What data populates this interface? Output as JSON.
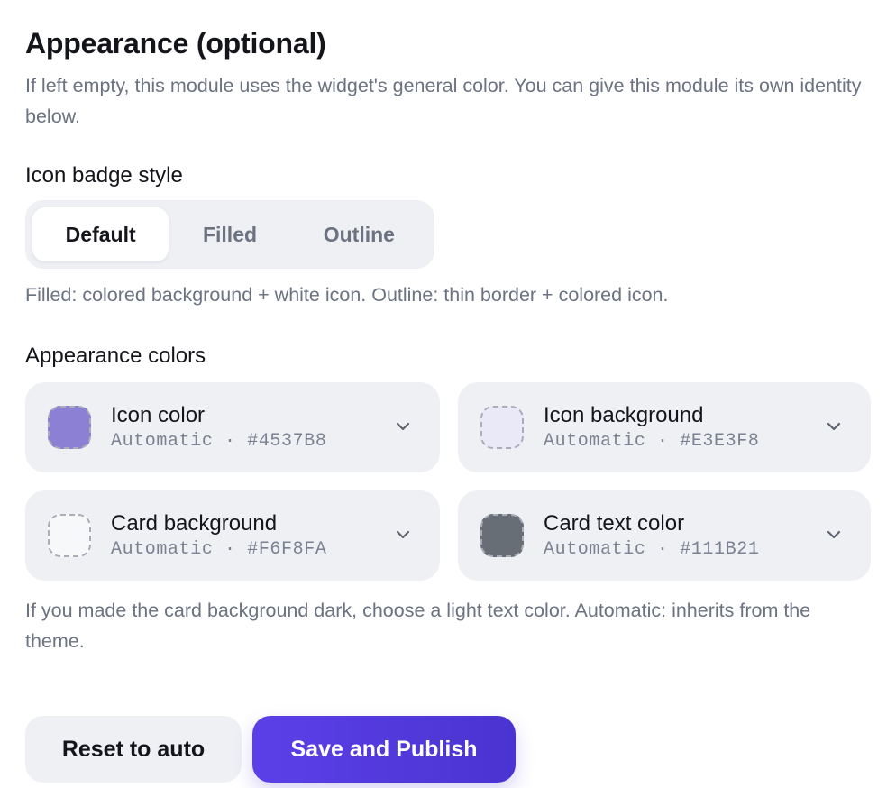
{
  "section": {
    "title": "Appearance (optional)",
    "description": "If left empty, this module uses the widget's general color. You can give this module its own identity below."
  },
  "badge_style": {
    "label": "Icon badge style",
    "options": [
      {
        "label": "Default",
        "selected": true
      },
      {
        "label": "Filled",
        "selected": false
      },
      {
        "label": "Outline",
        "selected": false
      }
    ],
    "hint": "Filled: colored background + white icon. Outline: thin border + colored icon."
  },
  "colors": {
    "label": "Appearance colors",
    "items": [
      {
        "title": "Icon color",
        "subtitle": "Automatic · #4537B8",
        "swatch": "#8b80d4",
        "icon": "chevron-down-icon"
      },
      {
        "title": "Icon background",
        "subtitle": "Automatic · #E3E3F8",
        "swatch": "#e9e9f8",
        "icon": "chevron-down-icon"
      },
      {
        "title": "Card background",
        "subtitle": "Automatic · #F6F8FA",
        "swatch": "#f6f8fa",
        "icon": "chevron-down-icon"
      },
      {
        "title": "Card text color",
        "subtitle": "Automatic · #111B21",
        "swatch": "#676e76",
        "icon": "chevron-down-icon"
      }
    ],
    "hint": "If you made the card background dark, choose a light text color. Automatic: inherits from the theme."
  },
  "actions": {
    "reset_label": "Reset to auto",
    "save_label": "Save and Publish",
    "accent": "#4f3bdc"
  }
}
